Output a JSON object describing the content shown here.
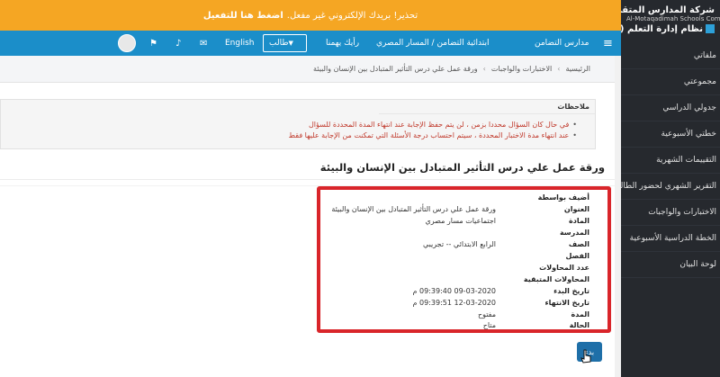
{
  "alert": {
    "text": "تحذير! بريدك الإلكتروني غير مفعل.",
    "link": "اضغط هنا للتفعيل"
  },
  "sidebar": {
    "brand_name": "شركة المدارس المتقدمة",
    "brand_en": "Al-Motaqadimah Schools Company",
    "system_name": "نظام إدارة التعلم (LMS)",
    "items": [
      {
        "label": "ملفاتي"
      },
      {
        "label": "مجموعتي"
      },
      {
        "label": "جدولي الدراسي"
      },
      {
        "label": "خطتي الأسبوعية"
      },
      {
        "label": "التقييمات الشهرية"
      },
      {
        "label": "التقرير الشهري لحضور الطالب"
      },
      {
        "label": "الاختبارات والواجبات"
      },
      {
        "label": "الخطة الدراسية الأسبوعية"
      },
      {
        "label": "لوحة البيان"
      }
    ]
  },
  "navbar": {
    "menu_icon": "hamburger-icon",
    "link1": "مدارس التضامن",
    "link2": "ابتدائية التضامن / المسار المصري",
    "link3": "رأيك يهمنا",
    "role": "طالب",
    "language": "English",
    "icons": [
      "mail-icon",
      "bell-icon",
      "flag-icon"
    ]
  },
  "breadcrumb": {
    "home": "الرئيسية",
    "section": "الاختبارات والواجبات",
    "current": "ورقة عمل علي درس التأثير المتبادل بين الإنسان والبيئة"
  },
  "notes": {
    "title": "ملاحظات",
    "items": [
      "في حال كان السؤال محددا بزمن ، لن يتم حفظ الإجابة عند انتهاء المدة المحددة للسؤال",
      "عند انتهاء مدة الاختبار المحددة ، سيتم احتساب درجة الأسئلة التي تمكنت من الإجابة عليها فقط"
    ]
  },
  "page_title": "ورقة عمل علي درس التأثير المتبادل بين الإنسان والبيئة",
  "details": {
    "added_by": {
      "label": "أضيف بواسطة",
      "value": ""
    },
    "title": {
      "label": "العنوان",
      "value": "ورقة عمل علي درس التأثير المتبادل بين الإنسان والبيئة"
    },
    "subject": {
      "label": "المادة",
      "value": "اجتماعيات مسار مصري"
    },
    "school": {
      "label": "المدرسة",
      "value": ""
    },
    "grade": {
      "label": "الصف",
      "value": "الرابع الابتدائي -- تجريبي"
    },
    "class": {
      "label": "الفصل",
      "value": ""
    },
    "attempts": {
      "label": "عدد المحاولات",
      "value": ""
    },
    "remaining": {
      "label": "المحاولات المتبقية",
      "value": ""
    },
    "start_date": {
      "label": "تاريخ البدء",
      "value": "09-03-2020 09:39:40 م"
    },
    "end_date": {
      "label": "تاريخ الانتهاء",
      "value": "12-03-2020 09:39:51 م"
    },
    "duration": {
      "label": "المدة",
      "value": "مفتوح"
    },
    "status": {
      "label": "الحالة",
      "value": "متاح"
    }
  },
  "back_button": "بدء",
  "colors": {
    "alert": "#f5a623",
    "navbar": "#1b8ec9",
    "sidebar": "#26292e",
    "highlight": "#d9252a",
    "note_text": "#c0392b"
  }
}
